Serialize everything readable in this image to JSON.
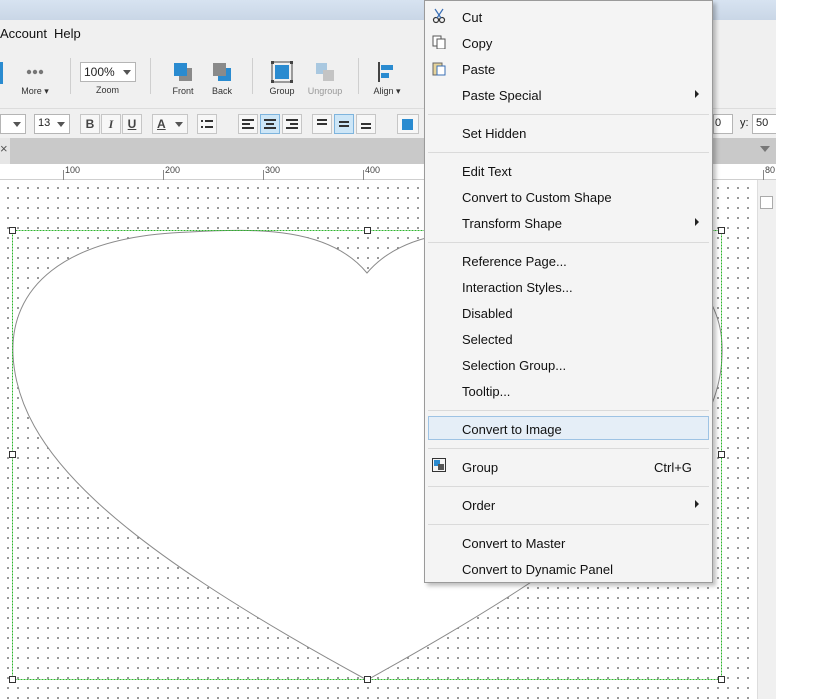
{
  "menubar": {
    "items": [
      "Account",
      "Help"
    ]
  },
  "toolbar": {
    "more": "More ▾",
    "zoom_value": "100%",
    "zoom": "Zoom",
    "front": "Front",
    "back": "Back",
    "group": "Group",
    "ungroup": "Ungroup",
    "align": "Align ▾"
  },
  "format": {
    "font_size": "13",
    "bold": "B",
    "italic": "I",
    "underline": "U",
    "font_color": "A",
    "y_label": "y:",
    "y_value": "50",
    "x_value_partial": "0"
  },
  "tabbar": {
    "close": "×"
  },
  "ruler": {
    "ticks": [
      "100",
      "200",
      "300",
      "400",
      "80"
    ]
  },
  "colors": {
    "accent": "#2a8bd0",
    "selection": "#2db52d",
    "menu_hover": "#e5eef7"
  },
  "context_menu": {
    "cut": "Cut",
    "copy": "Copy",
    "paste": "Paste",
    "paste_special": "Paste Special",
    "set_hidden": "Set Hidden",
    "edit_text": "Edit Text",
    "convert_custom_shape": "Convert to Custom Shape",
    "transform_shape": "Transform Shape",
    "reference_page": "Reference Page...",
    "interaction_styles": "Interaction Styles...",
    "disabled": "Disabled",
    "selected": "Selected",
    "selection_group": "Selection Group...",
    "tooltip": "Tooltip...",
    "convert_image": "Convert to Image",
    "group": "Group",
    "group_shortcut": "Ctrl+G",
    "order": "Order",
    "convert_master": "Convert to Master",
    "convert_dynamic_panel": "Convert to Dynamic Panel",
    "hovered_item": "Convert to Image",
    "icons": [
      "scissors-icon",
      "copy-icon",
      "paste-icon",
      "group-icon"
    ]
  }
}
